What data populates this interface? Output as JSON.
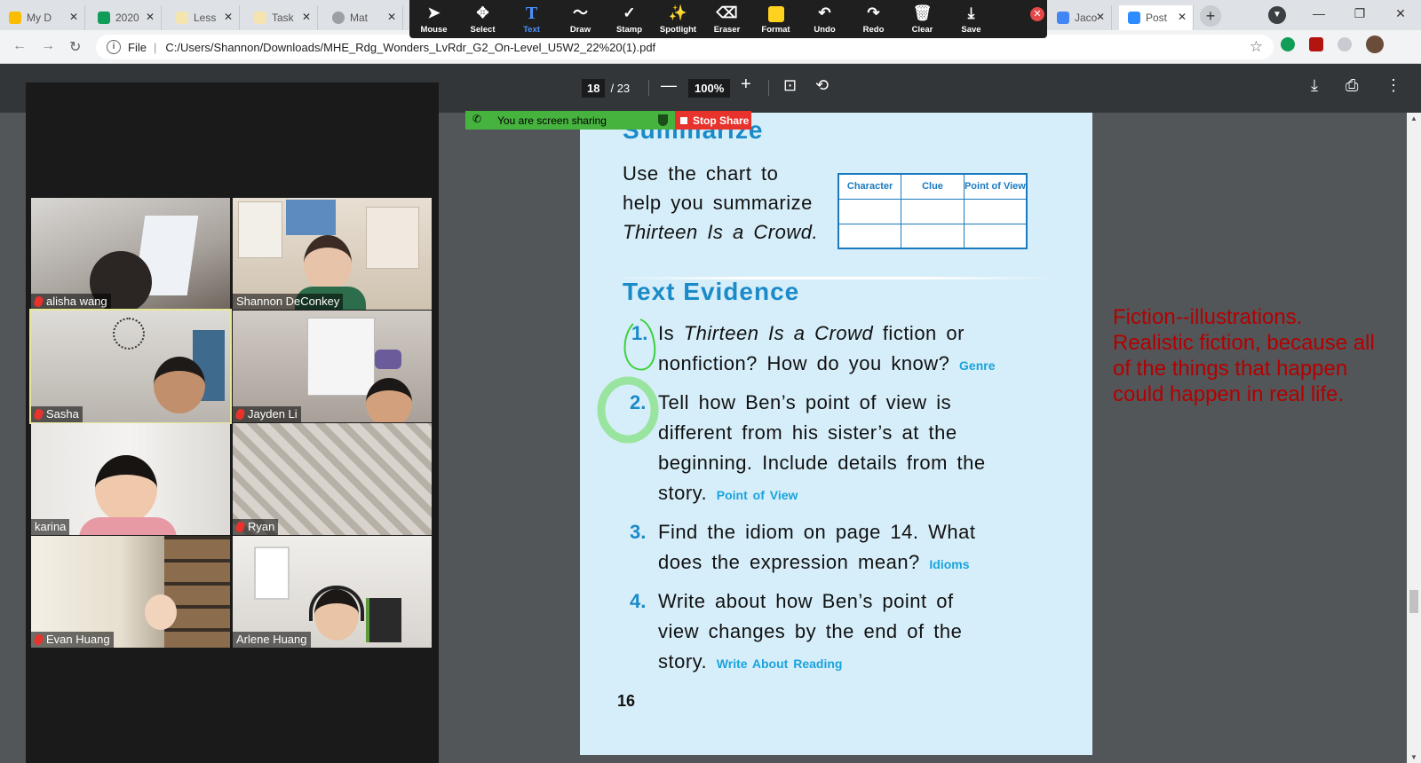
{
  "browser": {
    "tabs": [
      {
        "label": "My D",
        "color": "#fbbc04"
      },
      {
        "label": "2020",
        "color": "#0f9d58"
      },
      {
        "label": "Less",
        "color": "#f4e4b0"
      },
      {
        "label": "Task",
        "color": "#f4e4b0"
      },
      {
        "label": "Mat",
        "color": "#9aa0a6"
      },
      {
        "label": "Jaco",
        "color": "#4285f4"
      },
      {
        "label": "Post",
        "color": "#2d8cff"
      }
    ],
    "url_prefix": "File",
    "url": "C:/Users/Shannon/Downloads/MHE_Rdg_Wonders_LvRdr_G2_On-Level_U5W2_22%20(1).pdf"
  },
  "zoom_toolbar": {
    "tools": [
      {
        "label": "Mouse",
        "glyph": "➤"
      },
      {
        "label": "Select",
        "glyph": "✥"
      },
      {
        "label": "Text",
        "glyph": "T"
      },
      {
        "label": "Draw",
        "glyph": "〜"
      },
      {
        "label": "Stamp",
        "glyph": "✓"
      },
      {
        "label": "Spotlight",
        "glyph": "✨"
      },
      {
        "label": "Eraser",
        "glyph": "⌫"
      },
      {
        "label": "Format",
        "glyph": "■"
      },
      {
        "label": "Undo",
        "glyph": "↶"
      },
      {
        "label": "Redo",
        "glyph": "↷"
      },
      {
        "label": "Clear",
        "glyph": "🗑"
      },
      {
        "label": "Save",
        "glyph": "⤓"
      }
    ],
    "active_tool": "Text",
    "format_color": "#ffd21f"
  },
  "screen_share": {
    "status": "You are screen sharing",
    "stop_label": "Stop Share"
  },
  "pdf_toolbar": {
    "current_page": "18",
    "total_pages": "/ 23",
    "zoom": "100%"
  },
  "participants": [
    {
      "name": "alisha wang",
      "muted": true,
      "bg": "#9b9690"
    },
    {
      "name": "Shannon DeConkey",
      "muted": false,
      "bg": "#d9cfc1"
    },
    {
      "name": "Sasha",
      "muted": true,
      "bg": "#c9c7c2",
      "speaking": true
    },
    {
      "name": "Jayden Li",
      "muted": true,
      "bg": "#bdb7b2"
    },
    {
      "name": "karina",
      "muted": false,
      "bg": "#d5d2cf"
    },
    {
      "name": "Ryan",
      "muted": true,
      "bg": "#cfcac3"
    },
    {
      "name": "Evan Huang",
      "muted": true,
      "bg": "#a09886"
    },
    {
      "name": "Arlene Huang",
      "muted": false,
      "bg": "#dedad6"
    }
  ],
  "document": {
    "summarize_heading": "Summarize",
    "summarize_lines": [
      "Use the chart to",
      "help you summarize",
      "Thirteen Is a Crowd."
    ],
    "chart_headers": [
      "Character",
      "Clue",
      "Point of View"
    ],
    "text_evidence_heading": "Text Evidence",
    "questions": [
      {
        "num": "1.",
        "lines": [
          "Is Thirteen Is a Crowd fiction or",
          "nonfiction? How do you know?"
        ],
        "tag": "Genre"
      },
      {
        "num": "2.",
        "lines": [
          "Tell how Ben’s point of view is",
          "different from his sister’s at the",
          "beginning. Include details from the",
          "story."
        ],
        "tag": "Point of View"
      },
      {
        "num": "3.",
        "lines": [
          "Find the idiom on page 14. What",
          "does the expression mean?"
        ],
        "tag": "Idioms"
      },
      {
        "num": "4.",
        "lines": [
          "Write about how Ben’s point of",
          "view changes by the end of the",
          "story."
        ],
        "tag": "Write About Reading"
      }
    ],
    "page_number": "16"
  },
  "annotation": {
    "text": "Fiction--illustrations. Realistic fiction, because all of the things that happen could happen in real life.",
    "color": "#b40000"
  }
}
